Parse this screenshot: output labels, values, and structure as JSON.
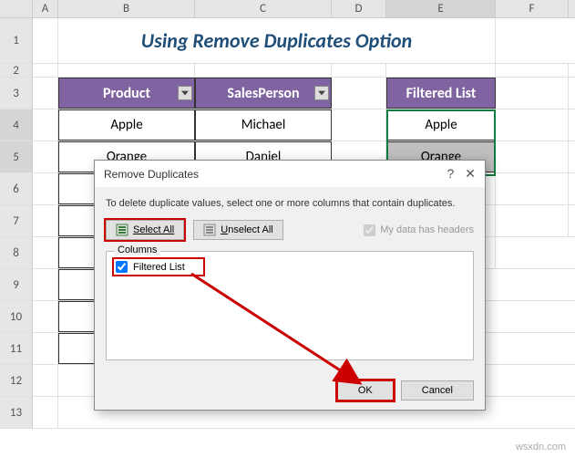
{
  "columns": [
    "A",
    "B",
    "C",
    "D",
    "E",
    "F"
  ],
  "rows": [
    "1",
    "2",
    "3",
    "4",
    "5",
    "6",
    "7",
    "8",
    "9",
    "10",
    "11",
    "12",
    "13"
  ],
  "title": "Using Remove Duplicates Option",
  "table": {
    "headers": {
      "b": "Product",
      "c": "SalesPerson",
      "e": "Filtered List"
    },
    "r4": {
      "b": "Apple",
      "c": "Michael",
      "e": "Apple"
    },
    "r5": {
      "b": "Orange",
      "c": "Daniel",
      "e": "Orange"
    }
  },
  "dialog": {
    "title": "Remove Duplicates",
    "help": "?",
    "close": "✕",
    "instruction": "To delete duplicate values, select one or more columns that contain duplicates.",
    "select_all": "Select All",
    "unselect_all": "Unselect All",
    "my_data_headers": "My data has headers",
    "columns_label": "Columns",
    "column_item": "Filtered List",
    "ok": "OK",
    "cancel": "Cancel"
  },
  "watermark": "wsxdn.com"
}
